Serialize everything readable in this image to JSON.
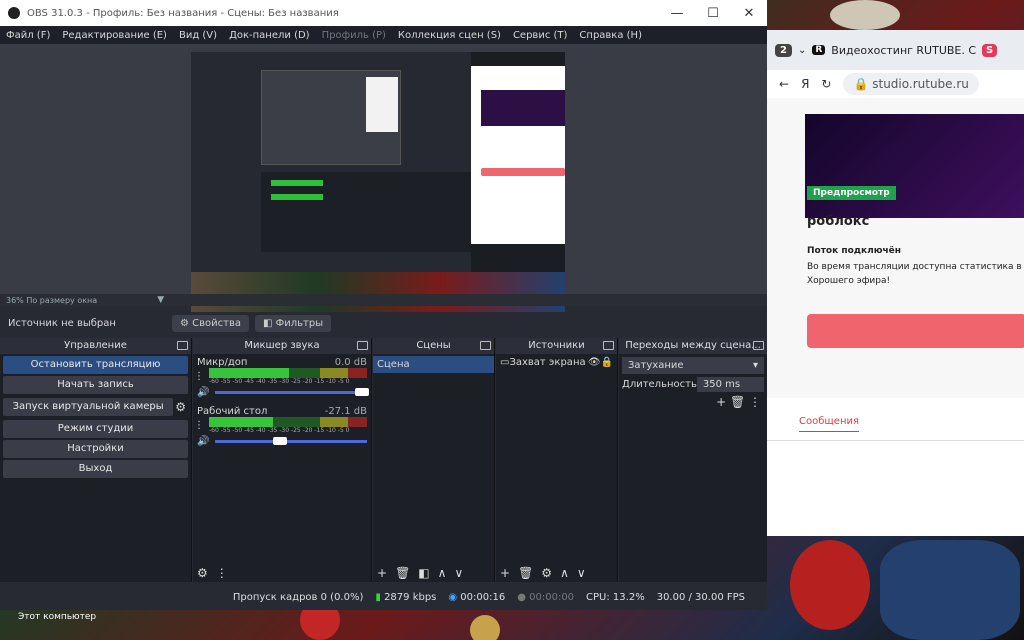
{
  "obs": {
    "title": "OBS 31.0.3 - Профиль: Без названия - Сцены: Без названия",
    "window_controls": [
      "—",
      "☐",
      "✕"
    ],
    "menu": [
      {
        "label": "Файл (F)",
        "enabled": true
      },
      {
        "label": "Редактирование (E)",
        "enabled": true
      },
      {
        "label": "Вид (V)",
        "enabled": true
      },
      {
        "label": "Док-панели (D)",
        "enabled": true
      },
      {
        "label": "Профиль (P)",
        "enabled": false
      },
      {
        "label": "Коллекция сцен (S)",
        "enabled": true
      },
      {
        "label": "Сервис (T)",
        "enabled": true
      },
      {
        "label": "Справка (H)",
        "enabled": true
      }
    ],
    "preview_zoom": "36% По размеру окна",
    "source_bar": {
      "status": "Источник не выбран",
      "properties": "Свойства",
      "filters": "Фильтры"
    },
    "docks": {
      "controls": "Управление",
      "mixer": "Микшер звука",
      "scenes": "Сцены",
      "sources": "Источники",
      "transitions": "Переходы между сцена..."
    },
    "controls": [
      "Остановить трансляцию",
      "Начать запись",
      "Запуск виртуальной камеры",
      "Режим студии",
      "Настройки",
      "Выход"
    ],
    "mixer": {
      "scale": "-60 -55 -50 -45 -40 -35 -30 -25 -20 -15 -10 -5 0",
      "tracks": [
        {
          "name": "Микр/доп",
          "db": "0.0 dB",
          "level": 0.72
        },
        {
          "name": "Рабочий стол",
          "db": "-27.1 dB",
          "level": 0.58
        }
      ]
    },
    "scenes": [
      "Сцена"
    ],
    "sources": [
      "Захват экрана"
    ],
    "transitions": {
      "type": "Затухание",
      "duration_label": "Длительность",
      "duration": "350 ms"
    },
    "status": {
      "dropped": "Пропуск кадров 0 (0.0%)",
      "bitrate": "2879 kbps",
      "stream_time": "00:00:16",
      "rec_time": "00:00:00",
      "cpu": "CPU: 13.2%",
      "fps": "30.00 / 30.00 FPS"
    }
  },
  "browser": {
    "tab_count": "2",
    "tab_title": "Видеохостинг RUTUBE. С",
    "url": "studio.rutube.ru",
    "preview_badge": "Предпросмотр",
    "stream_title": "роблокс",
    "stream_status": "Поток подключён",
    "stream_note": "Во время трансляции доступна статистика в ре",
    "stream_wish": "Хорошего эфира!",
    "messages_tab": "Сообщения"
  },
  "taskbar": {
    "computer_label": "Этот компьютер"
  },
  "colors": {
    "obs_bg": "#272a33",
    "obs_dock": "#1d1f27",
    "accent_blue": "#2b4e82",
    "rutube_red": "#f0646e",
    "rutube_green": "#1fa34a"
  }
}
